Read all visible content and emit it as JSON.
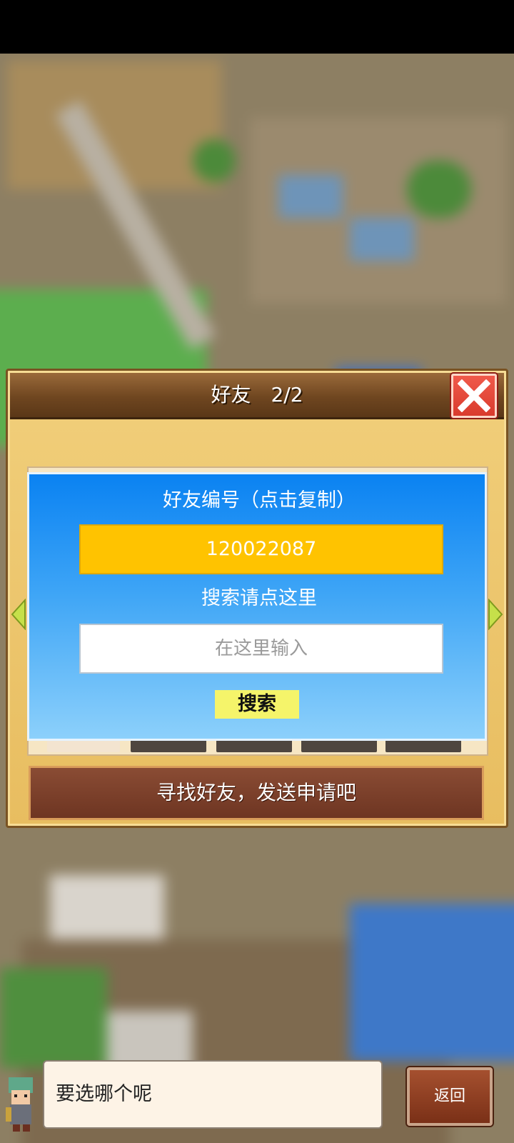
{
  "panel": {
    "title": "好友　2/2"
  },
  "dialog": {
    "id_label": "好友编号（点击复制）",
    "friend_id": "120022087",
    "search_label": "搜索请点这里",
    "search_placeholder": "在这里输入",
    "search_button": "搜索"
  },
  "find_friends_text": "寻找好友，发送申请吧",
  "bottom": {
    "speech_text": "要选哪个呢",
    "back_button": "返回"
  },
  "colors": {
    "panel_wood": "#e8bd60",
    "dialog_blue": "#0a82f2",
    "id_box": "#ffc300",
    "search_button": "#f5f46a",
    "close_button": "#e2473a"
  }
}
